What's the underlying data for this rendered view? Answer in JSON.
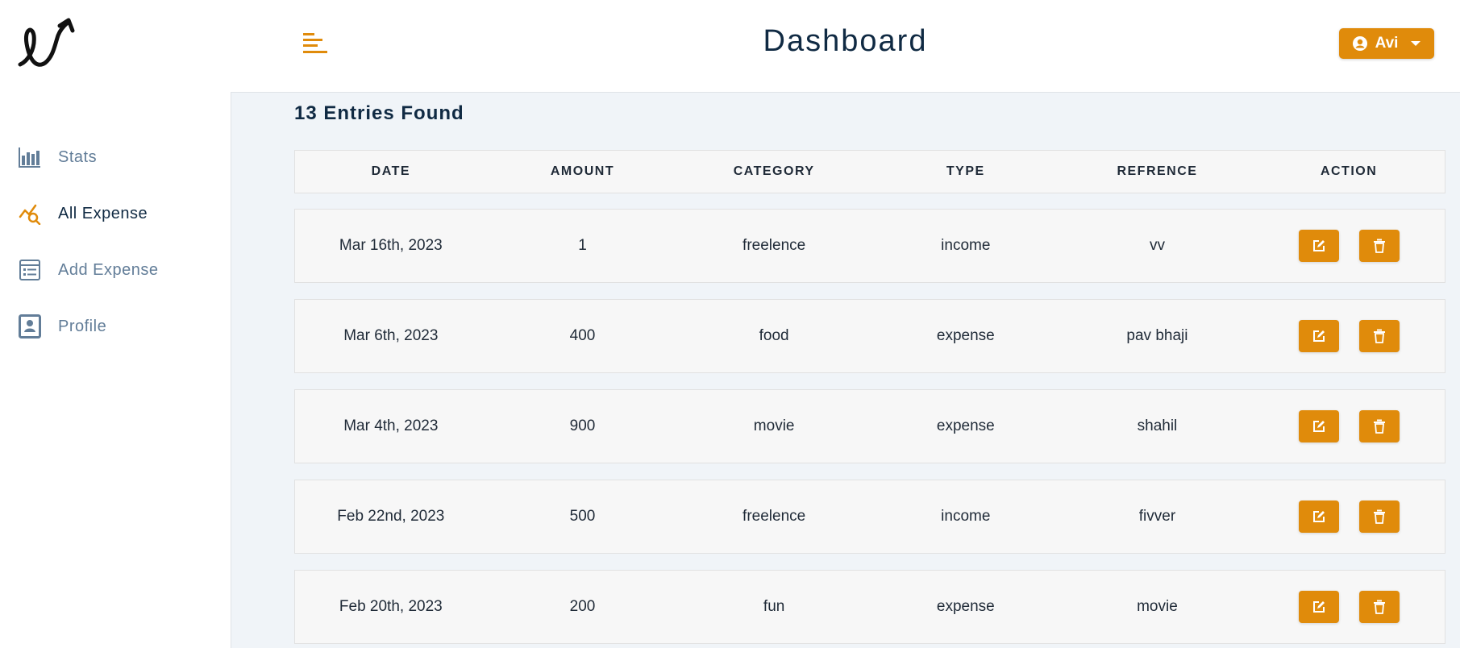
{
  "app": {
    "title": "Dashboard",
    "accent_color": "#e08b0b"
  },
  "sidebar": {
    "logo_icon": "expense-logo-icon",
    "items": [
      {
        "label": "Stats",
        "icon": "bar-chart-icon",
        "active": false
      },
      {
        "label": "All Expense",
        "icon": "chart-search-icon",
        "active": true
      },
      {
        "label": "Add Expense",
        "icon": "form-list-icon",
        "active": false
      },
      {
        "label": "Profile",
        "icon": "profile-card-icon",
        "active": false
      }
    ]
  },
  "header": {
    "menu_icon": "menu-toggle-icon",
    "user": {
      "name": "Avi",
      "icon": "user-circle-icon",
      "caret": "caret-down-icon"
    }
  },
  "main": {
    "entries_count": "13 Entries Found",
    "columns": [
      "DATE",
      "AMOUNT",
      "CATEGORY",
      "TYPE",
      "REFRENCE",
      "ACTION"
    ],
    "rows": [
      {
        "date": "Mar 16th, 2023",
        "amount": "1",
        "category": "freelence",
        "type": "income",
        "reference": "vv"
      },
      {
        "date": "Mar 6th, 2023",
        "amount": "400",
        "category": "food",
        "type": "expense",
        "reference": "pav bhaji"
      },
      {
        "date": "Mar 4th, 2023",
        "amount": "900",
        "category": "movie",
        "type": "expense",
        "reference": "shahil"
      },
      {
        "date": "Feb 22nd, 2023",
        "amount": "500",
        "category": "freelence",
        "type": "income",
        "reference": "fivver"
      },
      {
        "date": "Feb 20th, 2023",
        "amount": "200",
        "category": "fun",
        "type": "expense",
        "reference": "movie"
      }
    ],
    "row_actions": {
      "edit_icon": "edit-icon",
      "delete_icon": "trash-icon"
    }
  }
}
